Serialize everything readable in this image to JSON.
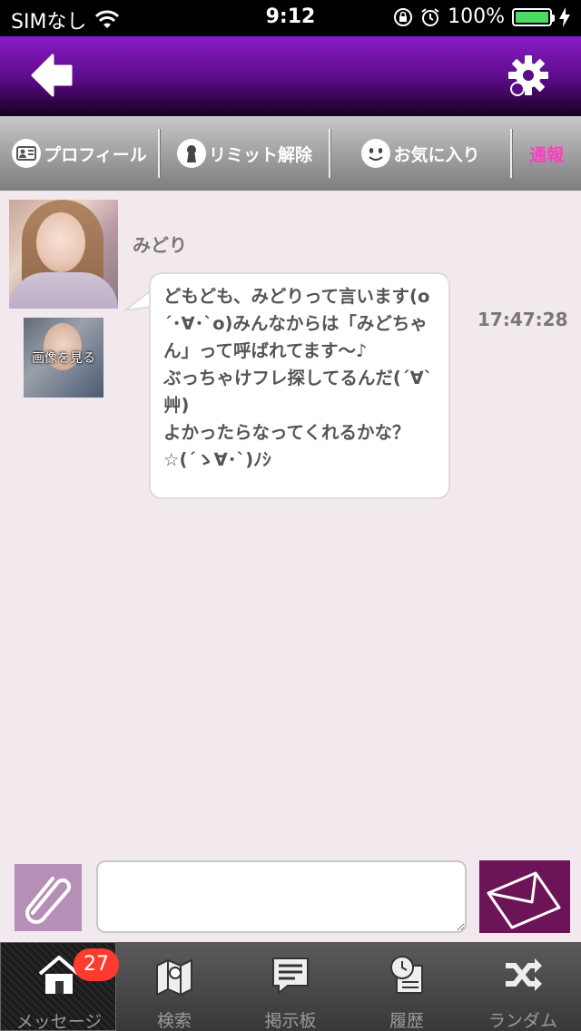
{
  "status_bar": {
    "carrier": "SIMなし",
    "time": "9:12",
    "battery": "100%"
  },
  "action_bar": {
    "profile": "プロフィール",
    "limit_release": "リミット解除",
    "favorite": "お気に入り",
    "report": "通報"
  },
  "message": {
    "sender": "みどり",
    "text": " どもども、みどりって言います(o´･∀･`o)みんなからは「みどちゃん」って呼ばれてます〜♪\nぶっちゃけフレ探してるんだ(´∀`艸)\nよかったらなってくれるかな？☆(´ゝ∀･`)ﾉｼ",
    "time": "17:47:28",
    "view_image": "画像を見る"
  },
  "composer": {
    "input_value": "",
    "input_placeholder": ""
  },
  "tabs": [
    {
      "label": "メッセージ",
      "icon": "house-icon",
      "badge": "27"
    },
    {
      "label": "検索",
      "icon": "map-search-icon"
    },
    {
      "label": "掲示板",
      "icon": "board-icon"
    },
    {
      "label": "履歴",
      "icon": "history-icon"
    },
    {
      "label": "ランダム",
      "icon": "shuffle-icon"
    }
  ],
  "colors": {
    "header_top": "#8a1cc8",
    "report": "#ff3dc4",
    "send_button": "#6c1457",
    "attach_button": "#b58fb5",
    "badge": "#ff3b30",
    "battery": "#4cd964"
  }
}
